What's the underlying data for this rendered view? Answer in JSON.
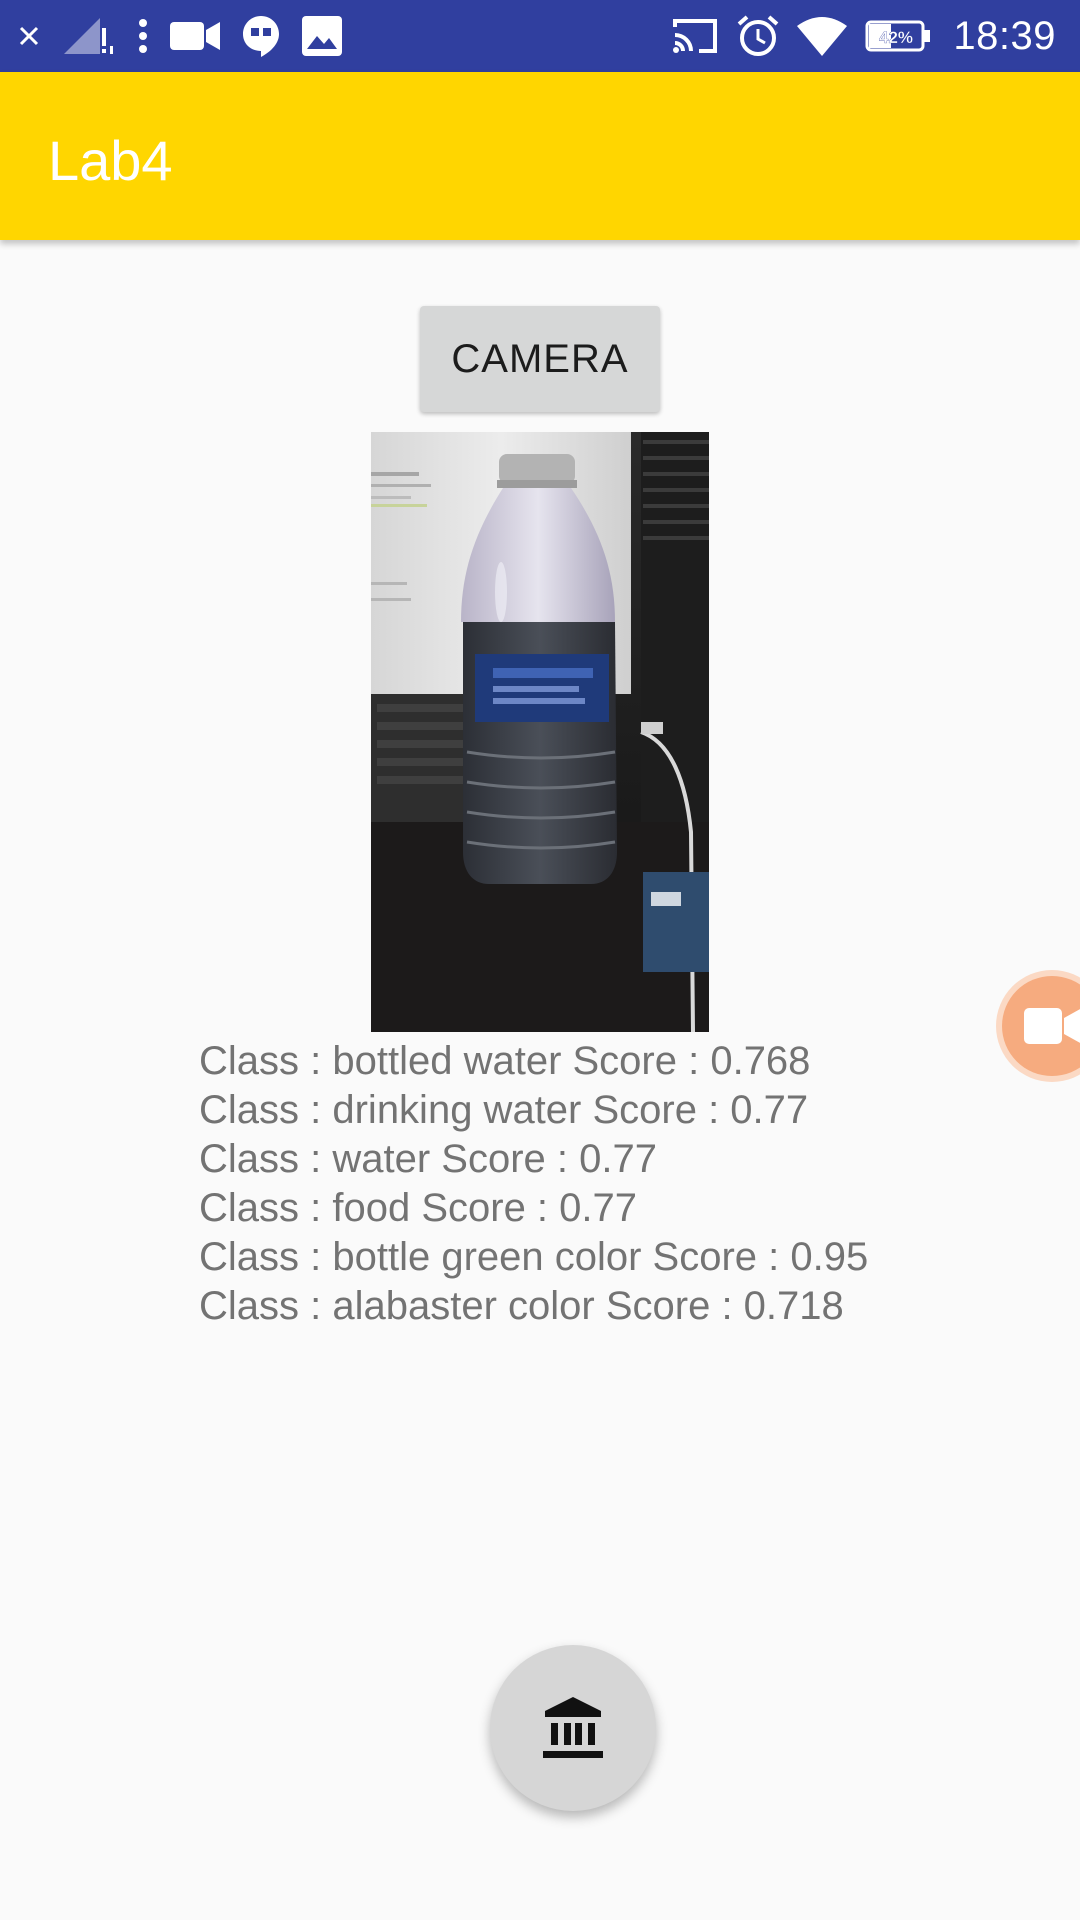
{
  "status_bar": {
    "time": "18:39",
    "battery": "42%",
    "icons": [
      "close-icon",
      "no-signal-icon",
      "more-vert-icon",
      "video-call-icon",
      "hangouts-icon",
      "image-icon",
      "cast-icon",
      "alarm-icon",
      "wifi-icon",
      "battery-icon"
    ]
  },
  "app_bar": {
    "title": "Lab4",
    "color": "#ffd600"
  },
  "camera_button": {
    "label": "CAMERA"
  },
  "results": [
    "Class : bottled water Score : 0.768",
    "Class : drinking water Score : 0.77",
    "Class : water Score : 0.77",
    "Class : food Score : 0.77",
    "Class : bottle green color Score : 0.95",
    "Class : alabaster color Score : 0.718"
  ],
  "fab": {
    "icon": "bank-icon"
  },
  "side_chip": {
    "icon": "video-camera-icon"
  },
  "colors": {
    "status_bar": "#303f9f",
    "app_bar": "#ffd600",
    "background": "#fafafa"
  }
}
